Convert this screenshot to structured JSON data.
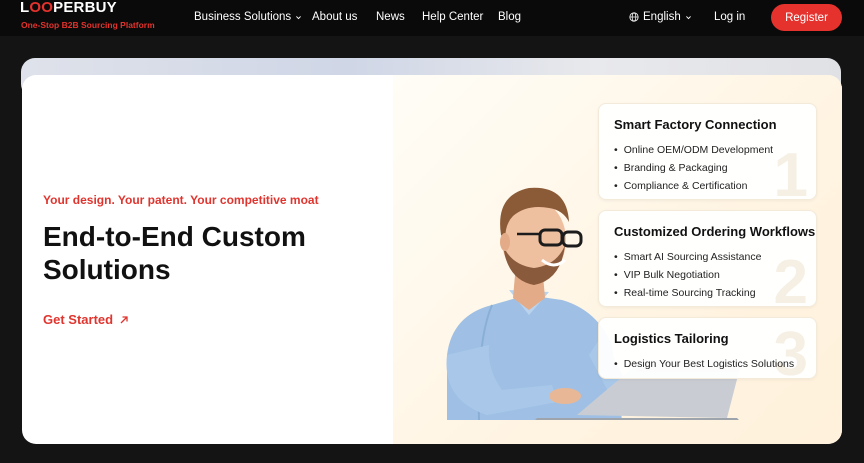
{
  "brand": {
    "name_part1": "L",
    "name_accent": "OO",
    "name_part2": "PERBUY",
    "tagline": "One-Stop B2B Sourcing Platform"
  },
  "nav": {
    "business_solutions": "Business Solutions",
    "about_us": "About us",
    "news": "News",
    "help_center": "Help Center",
    "blog": "Blog",
    "language": "English",
    "login": "Log in",
    "register": "Register"
  },
  "hero": {
    "eyebrow": "Your design. Your patent. Your competitive moat",
    "headline": "End-to-End Custom Solutions",
    "cta": "Get Started"
  },
  "features": [
    {
      "title": "Smart Factory Connection",
      "number": "1",
      "items": [
        "Online OEM/ODM Development",
        "Branding & Packaging",
        "Compliance & Certification"
      ]
    },
    {
      "title": "Customized Ordering Workflows",
      "number": "2",
      "items": [
        "Smart AI Sourcing Assistance",
        "VIP Bulk Negotiation",
        "Real-time Sourcing Tracking"
      ]
    },
    {
      "title": "Logistics Tailoring",
      "number": "3",
      "items": [
        "Design Your Best Logistics Solutions"
      ]
    }
  ],
  "colors": {
    "accent": "#e5322d",
    "nav_bg": "#0a0a0a",
    "page_bg": "#141414"
  }
}
